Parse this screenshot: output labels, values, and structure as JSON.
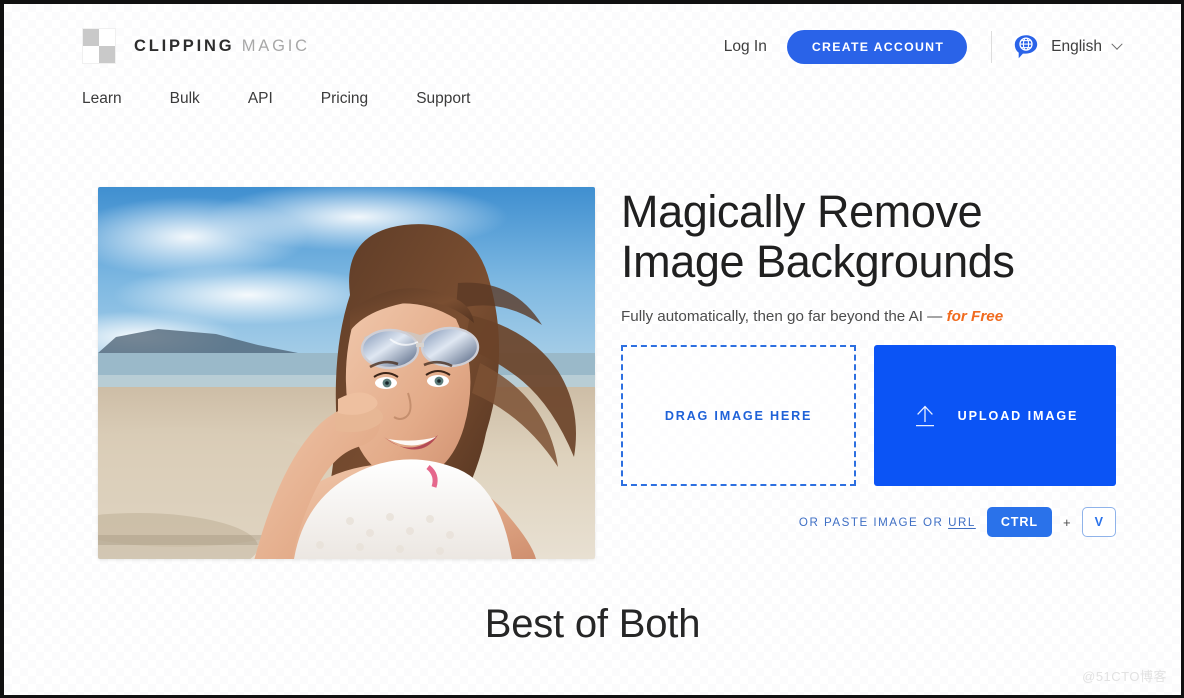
{
  "brand": {
    "word_bold": "CLIPPING",
    "word_light": "MAGIC",
    "logo_icon": "checkerboard-logo-icon"
  },
  "header": {
    "login_label": "Log In",
    "create_account_label": "CREATE ACCOUNT",
    "language_label": "English",
    "language_icon": "globe-speech-bubble-icon",
    "chevron_icon": "chevron-down-icon",
    "accent_blue": "#2a63e8"
  },
  "nav": {
    "items": [
      {
        "label": "Learn"
      },
      {
        "label": "Bulk"
      },
      {
        "label": "API"
      },
      {
        "label": "Pricing"
      },
      {
        "label": "Support"
      }
    ]
  },
  "hero": {
    "title_line1": "Magically Remove",
    "title_line2": "Image Backgrounds",
    "subtitle_prefix": "Fully automatically, then go far beyond the AI — ",
    "subtitle_highlight": "for Free",
    "highlight_color": "#f06a1e",
    "photo_alt": "woman-on-beach-photo",
    "dropzone_label": "DRAG IMAGE HERE",
    "dropzone_border_color": "#2d6fe0",
    "upload_label": "UPLOAD IMAGE",
    "upload_icon": "upload-arrow-icon",
    "upload_button_color": "#0b54f5",
    "paste_text_prefix": "OR PASTE IMAGE OR ",
    "paste_text_link": "URL",
    "key_ctrl": "CTRL",
    "key_plus": "+",
    "key_v": "V"
  },
  "section": {
    "heading": "Best of Both"
  },
  "watermark": {
    "text": "@51CTO博客"
  }
}
